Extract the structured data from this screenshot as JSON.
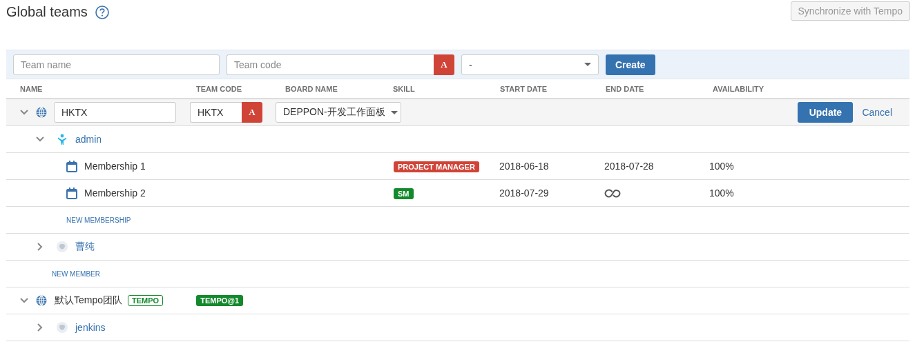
{
  "page": {
    "title": "Global teams"
  },
  "sync_button": {
    "label": "Synchronize with Tempo",
    "disabled": true
  },
  "create_form": {
    "team_name": {
      "placeholder": "Team name"
    },
    "team_code": {
      "placeholder": "Team code"
    },
    "code_button": "A",
    "board_select": {
      "value": "-"
    },
    "create_button": "Create"
  },
  "table": {
    "columns": [
      "NAME",
      "TEAM CODE",
      "BOARD NAME",
      "SKILL",
      "START DATE",
      "END DATE",
      "AVAILABILITY"
    ],
    "teams": [
      {
        "kind": "editing",
        "expanded": true,
        "name": "HKTX",
        "code": "HKTX",
        "code_button": "A",
        "board": "DEPPON-开发工作面板",
        "actions": [
          "Update",
          "Cancel"
        ],
        "members": [
          {
            "kind": "figure",
            "name": "admin",
            "expanded": true,
            "memberships": [
              {
                "name": "Membership 1",
                "skill": {
                  "label": "PROJECT MANAGER",
                  "color": "#d04437"
                },
                "start_date": "2018-06-18",
                "end": {
                  "kind": "date",
                  "text": "2018-07-28"
                },
                "availability": "100%"
              },
              {
                "name": "Membership 2",
                "skill": {
                  "label": "SM",
                  "color": "#14892c"
                },
                "start_date": "2018-07-29",
                "end": {
                  "kind": "open"
                },
                "availability": "100%"
              }
            ],
            "new_membership": "NEW MEMBERSHIP"
          },
          {
            "kind": "placeholder",
            "name": "曹纯",
            "expanded": false
          }
        ],
        "new_member": "NEW MEMBER"
      },
      {
        "kind": "view",
        "expanded": true,
        "name": "默认Tempo团队",
        "tag": "TEMPO",
        "code": "TEMPO@1",
        "members": [
          {
            "kind": "placeholder",
            "name": "jenkins",
            "expanded": false
          }
        ]
      }
    ]
  }
}
